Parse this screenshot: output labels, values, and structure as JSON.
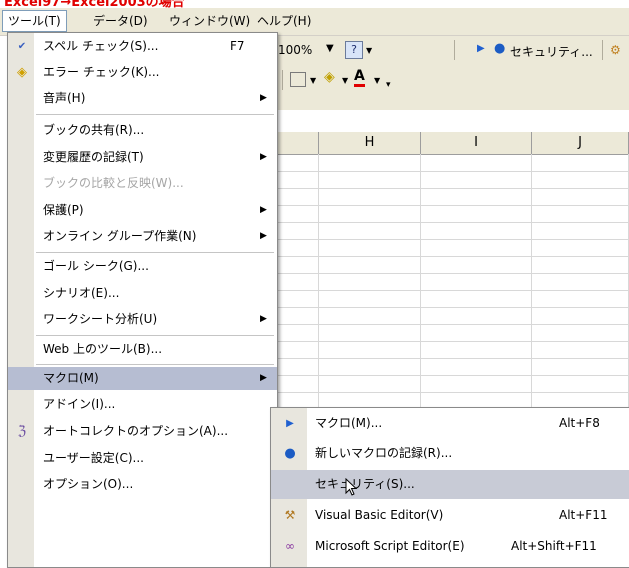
{
  "menubar": {
    "items": [
      {
        "label": "ツール(T)"
      },
      {
        "label": "データ(D)"
      },
      {
        "label": "ウィンドウ(W)"
      },
      {
        "label": "ヘルプ(H)"
      }
    ]
  },
  "toolbar": {
    "zoom": "100%",
    "security_label": "セキュリティ..."
  },
  "sheet": {
    "columns": [
      "H",
      "I",
      "J"
    ]
  },
  "tools_menu": {
    "items": [
      {
        "label": "スペル チェック(S)...",
        "shortcut": "F7",
        "icon": "spell-check-icon"
      },
      {
        "label": "エラー チェック(K)...",
        "icon": "error-check-icon"
      },
      {
        "label": "音声(H)",
        "submenu": true
      },
      {
        "label": "ブックの共有(R)..."
      },
      {
        "label": "変更履歴の記録(T)",
        "submenu": true
      },
      {
        "label": "ブックの比較と反映(W)...",
        "disabled": true
      },
      {
        "label": "保護(P)",
        "submenu": true
      },
      {
        "label": "オンライン グループ作業(N)",
        "submenu": true
      },
      {
        "label": "ゴール シーク(G)..."
      },
      {
        "label": "シナリオ(E)..."
      },
      {
        "label": "ワークシート分析(U)",
        "submenu": true
      },
      {
        "label": "Web 上のツール(B)..."
      },
      {
        "label": "マクロ(M)",
        "submenu": true,
        "selected": true
      },
      {
        "label": "アドイン(I)..."
      },
      {
        "label": "オートコレクトのオプション(A)...",
        "icon": "autocorrect-icon"
      },
      {
        "label": "ユーザー設定(C)..."
      },
      {
        "label": "オプション(O)..."
      }
    ]
  },
  "macro_submenu": {
    "items": [
      {
        "label": "マクロ(M)...",
        "shortcut": "Alt+F8",
        "icon": "play-icon"
      },
      {
        "label": "新しいマクロの記録(R)...",
        "icon": "record-icon"
      },
      {
        "label": "セキュリティ(S)...",
        "selected": true
      },
      {
        "label": "Visual Basic Editor(V)",
        "shortcut": "Alt+F11",
        "icon": "vb-editor-icon"
      },
      {
        "label": "Microsoft Script Editor(E)",
        "shortcut": "Alt+Shift+F11",
        "icon": "script-editor-icon"
      }
    ]
  },
  "colors": {
    "menu_selected": "#b6bdd2",
    "menubar_bg": "#ece9d8",
    "banner_text": "#e00000"
  }
}
